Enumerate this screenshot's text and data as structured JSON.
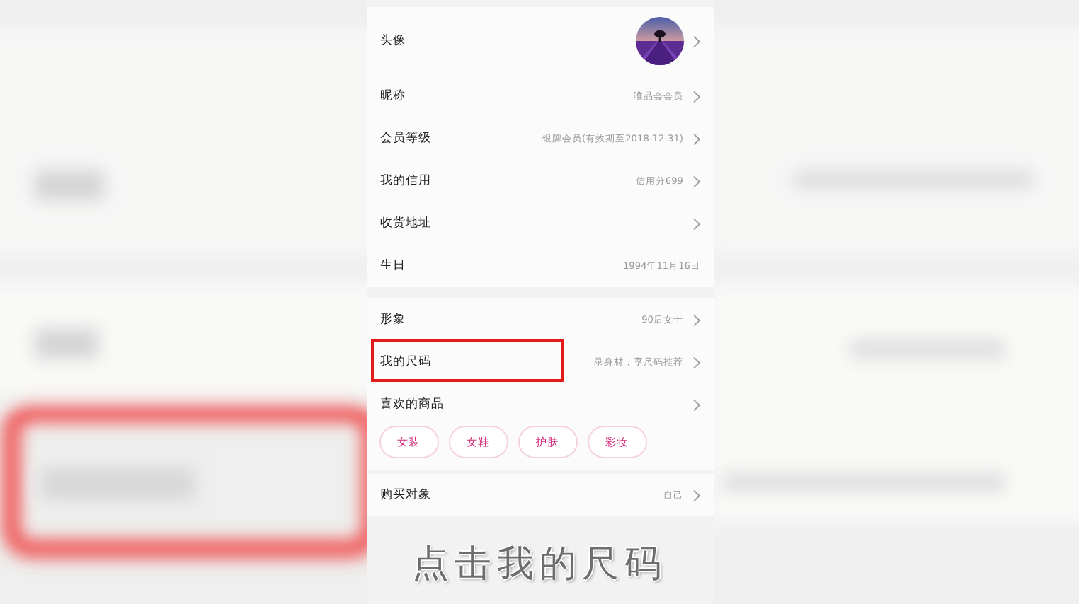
{
  "groups": [
    [
      {
        "kind": "avatar",
        "label": "头像",
        "chevron": true,
        "highlighted": false
      },
      {
        "kind": "text",
        "label": "昵称",
        "value": "唯品会会员",
        "chevron": true,
        "highlighted": false
      },
      {
        "kind": "text",
        "label": "会员等级",
        "value": "银牌会员(有效期至2018-12-31)",
        "chevron": true,
        "highlighted": false
      },
      {
        "kind": "text",
        "label": "我的信用",
        "value": "信用分699",
        "chevron": true,
        "highlighted": false
      },
      {
        "kind": "text",
        "label": "收货地址",
        "chevron": true,
        "highlighted": false
      },
      {
        "kind": "text",
        "label": "生日",
        "value": "1994年11月16日",
        "chevron": false,
        "highlighted": false
      }
    ],
    [
      {
        "kind": "text",
        "label": "形象",
        "value": "90后女士",
        "chevron": true,
        "highlighted": false
      },
      {
        "kind": "text",
        "label": "我的尺码",
        "value": "录身材，享尺码推荐",
        "chevron": true,
        "highlighted": true
      },
      {
        "kind": "tags",
        "label": "喜欢的商品",
        "chevron": true,
        "highlighted": false,
        "tags": [
          "女装",
          "女鞋",
          "护肤",
          "彩妆"
        ]
      }
    ],
    [
      {
        "kind": "text",
        "label": "购买对象",
        "value": "自己",
        "chevron": true,
        "highlighted": false
      }
    ]
  ],
  "caption": "点击我的尺码"
}
